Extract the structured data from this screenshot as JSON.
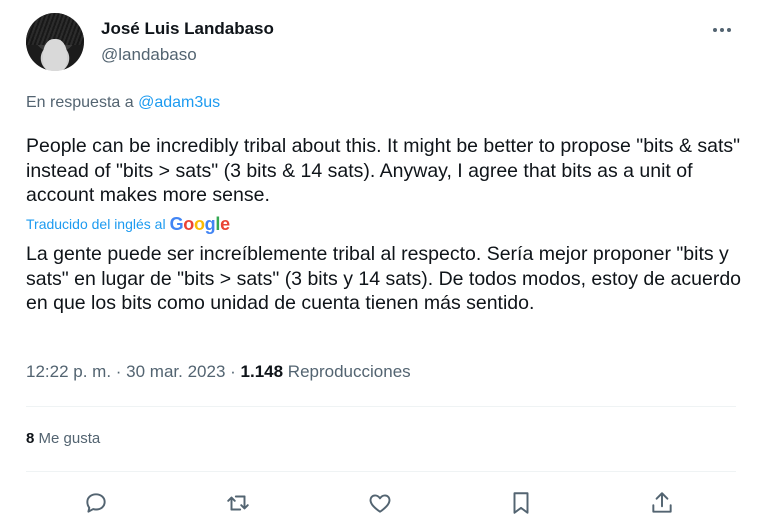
{
  "author": {
    "name": "José Luis Landabaso",
    "handle": "@landabaso"
  },
  "reply": {
    "prefix": "En respuesta a ",
    "mention": "@adam3us"
  },
  "tweet": {
    "text": "People can be incredibly tribal about this. It might be better to propose \"bits & sats\" instead of \"bits > sats\" (3 bits & 14 sats). Anyway, I agree that bits as a unit of account makes more sense."
  },
  "translation": {
    "label": "Traducido del inglés al",
    "provider": "Google",
    "text": "La gente puede ser increíblemente tribal al respecto. Sería mejor proponer \"bits y sats\" en lugar de \"bits > sats\" (3 bits y 14 sats). De todos modos, estoy de acuerdo en que los bits como unidad de cuenta tienen más sentido."
  },
  "meta": {
    "time": "12:22 p. m.",
    "sep1": " · ",
    "date": "30 mar. 2023",
    "sep2": " · ",
    "views_count": "1.148",
    "views_label": " Reproducciones"
  },
  "engagement": {
    "likes_count": "8",
    "likes_label": " Me gusta"
  },
  "icons": {
    "more": "more-horizontal-icon",
    "reply": "reply-icon",
    "retweet": "retweet-icon",
    "like": "like-icon",
    "bookmark": "bookmark-icon",
    "share": "share-icon"
  },
  "colors": {
    "text": "#0f1419",
    "secondary": "#536471",
    "accent": "#1d9bf0",
    "divider": "#eff3f4"
  }
}
